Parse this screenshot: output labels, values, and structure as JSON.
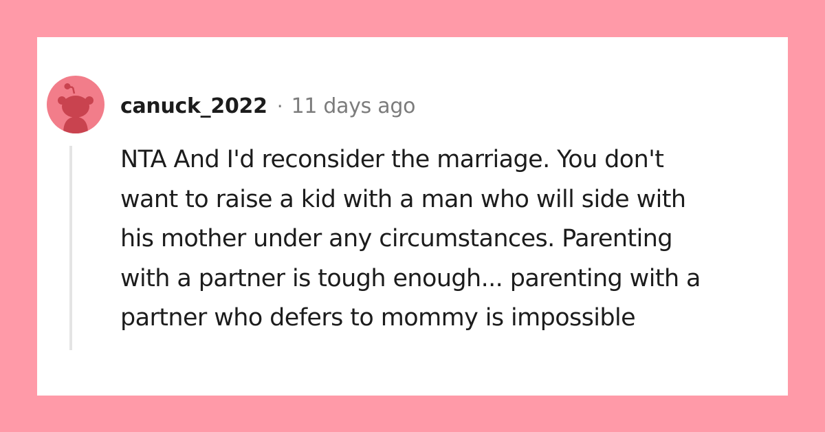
{
  "comment": {
    "username": "canuck_2022",
    "separator": "·",
    "timestamp": "11 days ago",
    "avatar_icon": "reddit-snoo-icon",
    "body_lines": [
      "NTA And I'd reconsider the marriage. You don't",
      "want to raise a kid with a man who will side with",
      "his mother under any circumstances. Parenting",
      "with a partner is tough enough... parenting with a",
      "partner who defers to mommy is impossible"
    ]
  },
  "colors": {
    "frame": "#ff9aa8",
    "avatar_bg": "#f27d8a",
    "avatar_figure": "#c9434f",
    "text": "#1c1c1c",
    "muted": "#7c7c7c",
    "thread_line": "#e4e4e4"
  }
}
